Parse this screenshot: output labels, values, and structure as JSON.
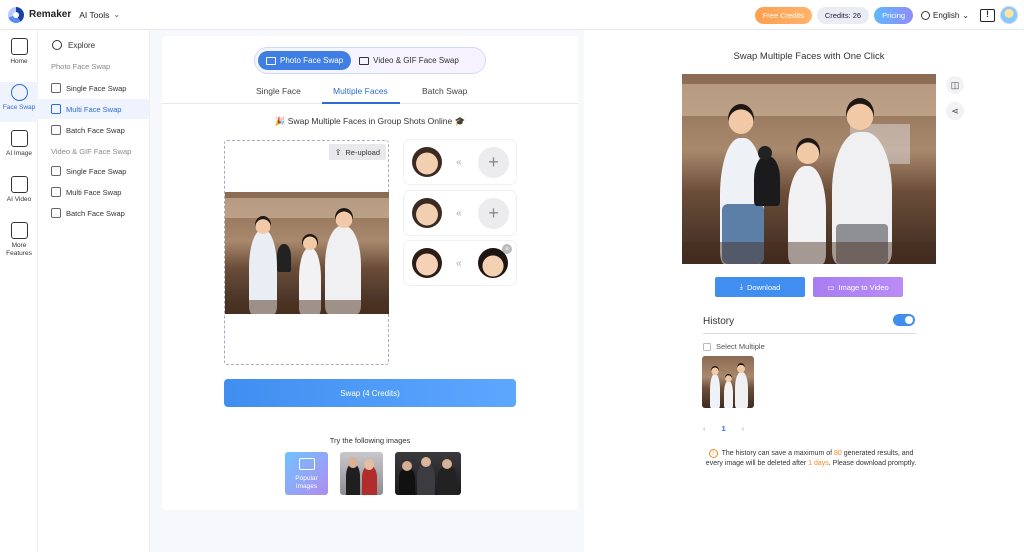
{
  "header": {
    "brand": "Remaker",
    "ai_tools": "AI Tools",
    "free_credits": "Free Credits",
    "credits": "Credits: 26",
    "pricing": "Pricing",
    "language": "English"
  },
  "rail": [
    {
      "label": "Home",
      "icon": "home-icon"
    },
    {
      "label": "Face Swap",
      "icon": "face-swap-icon"
    },
    {
      "label": "AI Image",
      "icon": "image-icon"
    },
    {
      "label": "AI Video",
      "icon": "video-icon"
    },
    {
      "label": "More Features",
      "icon": "grid-icon"
    }
  ],
  "sidebar": {
    "explore": "Explore",
    "group_photo": "Photo Face Swap",
    "photo_items": [
      "Single Face Swap",
      "Multi Face Swap",
      "Batch Face Swap"
    ],
    "group_video": "Video & GIF Face Swap",
    "video_items": [
      "Single Face Swap",
      "Multi Face Swap",
      "Batch Face Swap"
    ]
  },
  "editor": {
    "mode_photo": "Photo Face Swap",
    "mode_video": "Video & GIF Face Swap",
    "tabs": [
      "Single Face",
      "Multiple Faces",
      "Batch Swap"
    ],
    "subtitle": "Swap Multiple Faces in Group Shots Online",
    "reupload": "Re-upload",
    "swap_button": "Swap (4 Credits)",
    "try_label": "Try the following images",
    "popular_images": "Popular Images"
  },
  "result": {
    "title": "Swap Multiple Faces with One Click",
    "download": "Download",
    "image_to_video": "Image to Video"
  },
  "history": {
    "title": "History",
    "select_multiple": "Select Multiple",
    "page": "1",
    "note_pre": "The history can save a maximum of ",
    "note_max": "80",
    "note_mid": " generated results, and every image will be deleted after ",
    "note_days": "1 days",
    "note_post": ". Please download promptly."
  },
  "colors": {
    "accent": "#3f8ef0",
    "active_text": "#2f6bd7",
    "orange": "#f08a24",
    "purple": "#a77df2"
  }
}
